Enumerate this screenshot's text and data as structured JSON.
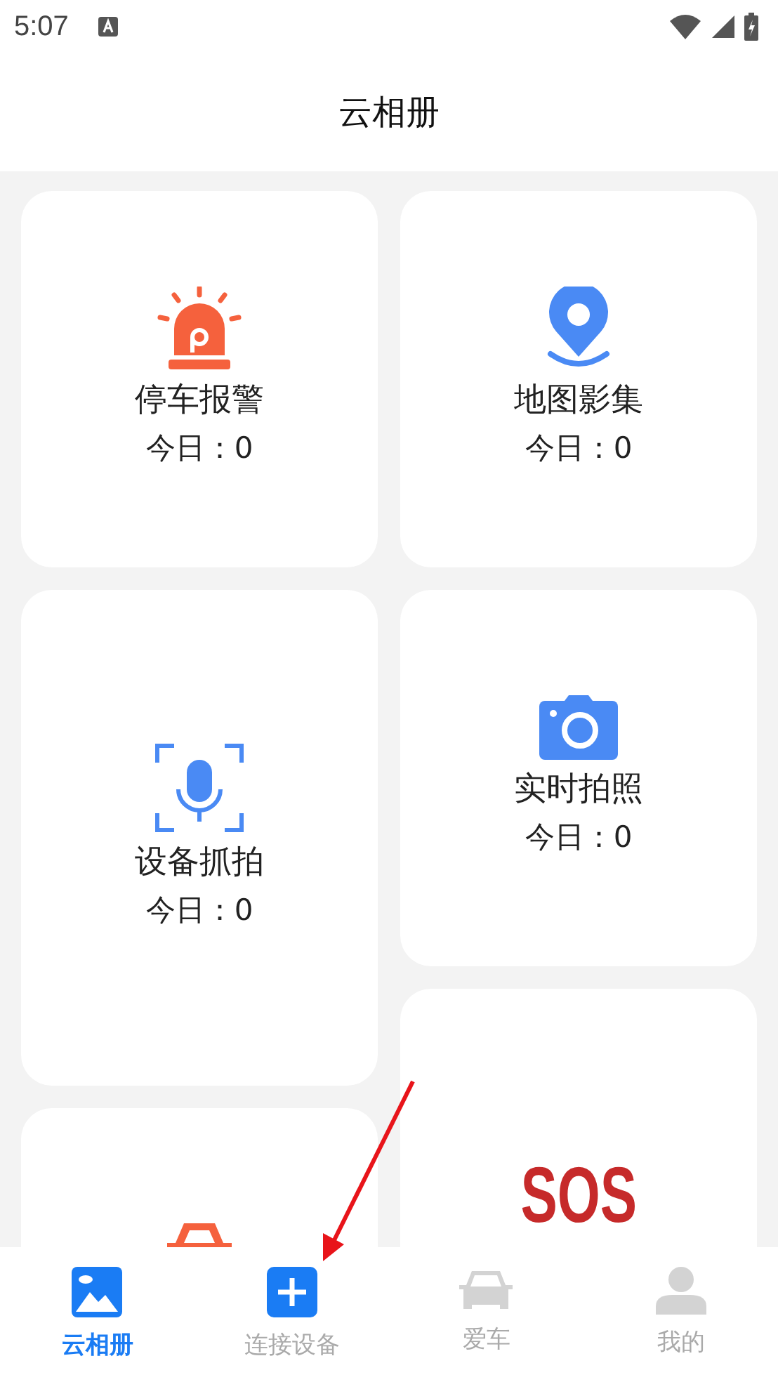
{
  "status_bar": {
    "time": "5:07"
  },
  "header": {
    "title": "云相册"
  },
  "columns": [
    {
      "cards": [
        {
          "kind": "alarm",
          "label": "停车报警",
          "count": "今日：0"
        },
        {
          "kind": "mic",
          "label": "设备抓拍",
          "count": "今日：0"
        },
        {
          "kind": "car"
        }
      ]
    },
    {
      "cards": [
        {
          "kind": "pin",
          "label": "地图影集",
          "count": "今日：0"
        },
        {
          "kind": "camera",
          "label": "实时拍照",
          "count": "今日：0"
        },
        {
          "kind": "sos",
          "logo": "SOS"
        }
      ]
    }
  ],
  "bottom_nav": [
    {
      "kind": "gallery",
      "label": "云相册",
      "selected": true
    },
    {
      "kind": "plus",
      "label": "连接设备",
      "selected": false
    },
    {
      "kind": "car",
      "label": "爱车",
      "selected": false
    },
    {
      "kind": "person",
      "label": "我的",
      "selected": false
    }
  ],
  "annotation": {
    "kind": "arrow"
  }
}
